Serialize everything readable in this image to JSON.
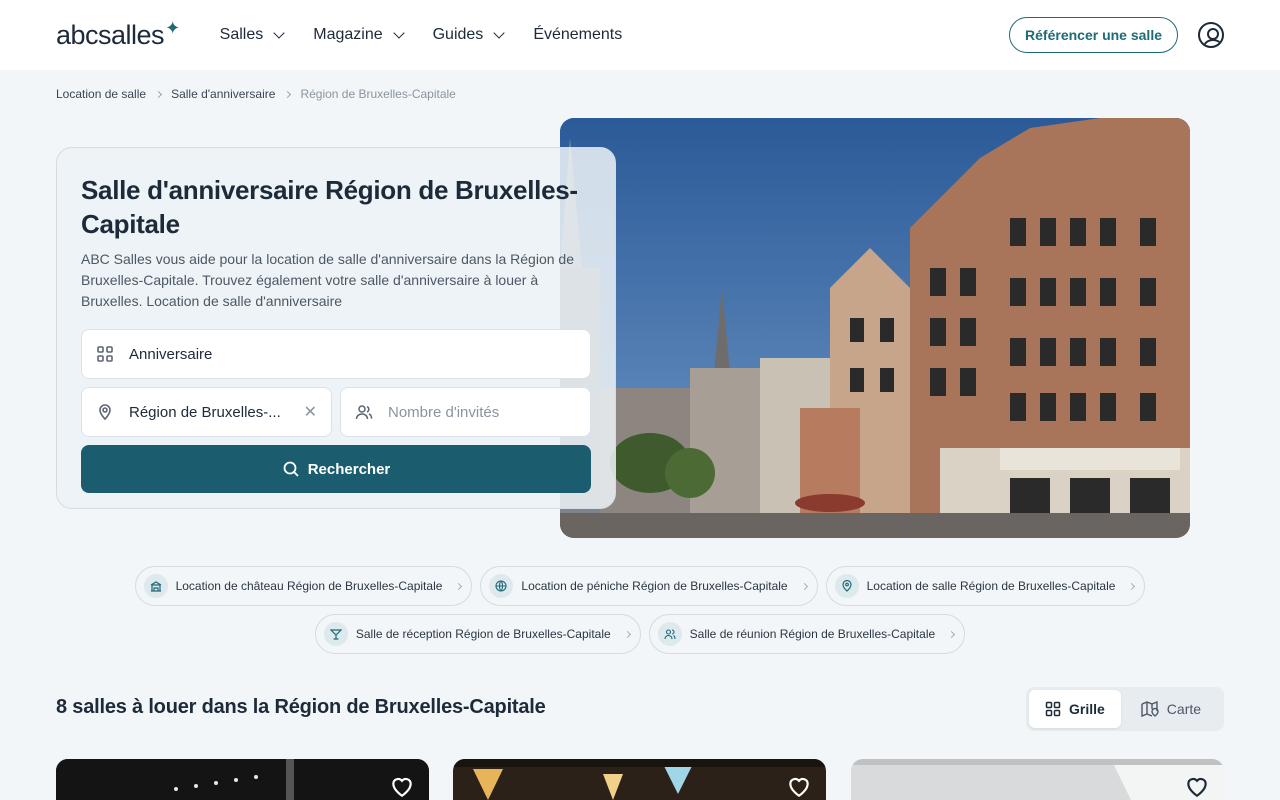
{
  "header": {
    "logo_text": "abcsalles",
    "nav": [
      {
        "label": "Salles",
        "has_dropdown": true
      },
      {
        "label": "Magazine",
        "has_dropdown": true
      },
      {
        "label": "Guides",
        "has_dropdown": true
      },
      {
        "label": "Événements",
        "has_dropdown": false
      }
    ],
    "cta_label": "Référencer une salle"
  },
  "breadcrumb": {
    "items": [
      "Location de salle",
      "Salle d'anniversaire",
      "Région de Bruxelles-Capitale"
    ]
  },
  "hero": {
    "title": "Salle d'anniversaire Région de Bruxelles-Capitale",
    "description": "ABC Salles vous aide pour la location de salle d'anniversaire dans la Région de Bruxelles-Capitale. Trouvez également votre salle d'anniversaire à louer à Bruxelles. Location de salle d'anniversaire"
  },
  "search": {
    "event_type_value": "Anniversaire",
    "location_value": "Région de Bruxelles-...",
    "guests_placeholder": "Nombre d'invités",
    "submit_label": "Rechercher"
  },
  "chips": [
    {
      "label": "Location de château Région de Bruxelles-Capitale",
      "icon": "castle-icon"
    },
    {
      "label": "Location de péniche Région de Bruxelles-Capitale",
      "icon": "globe-icon"
    },
    {
      "label": "Location de salle Région de Bruxelles-Capitale",
      "icon": "pin-icon"
    },
    {
      "label": "Salle de réception Région de Bruxelles-Capitale",
      "icon": "cocktail-icon"
    },
    {
      "label": "Salle de réunion Région de Bruxelles-Capitale",
      "icon": "people-icon"
    }
  ],
  "results": {
    "title": "8 salles à louer dans la Région de Bruxelles-Capitale",
    "view_grid_label": "Grille",
    "view_map_label": "Carte",
    "active_view": "grid"
  },
  "colors": {
    "brand": "#1b5d6e",
    "accent_outline": "#1e6b78",
    "page_bg": "#f2f6f8"
  }
}
